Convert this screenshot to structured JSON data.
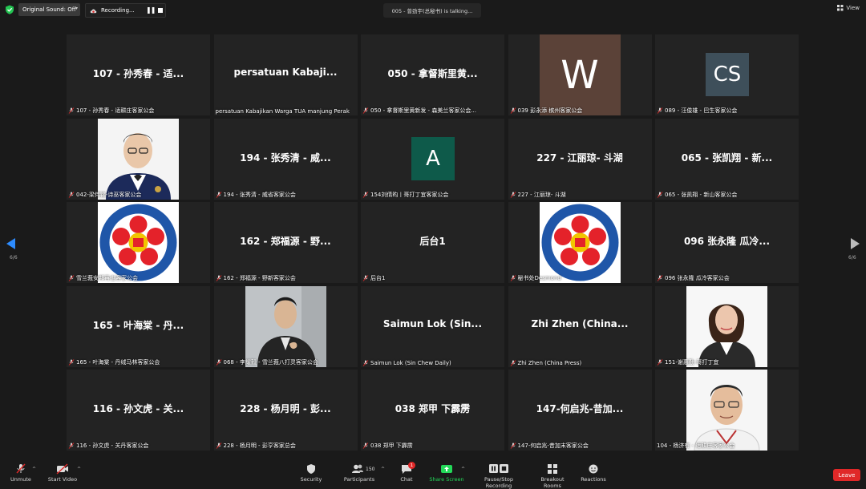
{
  "top": {
    "sound_label": "Original Sound: Off",
    "recording_label": "Recording...",
    "talking_label": "005 - 曾劲宇(总秘书)  is  talking...",
    "view_label": "View"
  },
  "tiles": [
    {
      "name": "107 - 孙秀春 - 适...",
      "caption": "107 - 孙秀春 - 适耕庄客家公会",
      "kind": "text"
    },
    {
      "name": "persatuan Kabaji...",
      "caption": "persatuan Kabajikan Warga TUA manjung Perak",
      "kind": "text",
      "nomic": true
    },
    {
      "name": "050 - 拿督斯里黄...",
      "caption": "050 - 拿督斯里黄新发 - 森美兰客家公会...",
      "kind": "text"
    },
    {
      "name": "",
      "caption": "039  彭永添 槟州客家公会",
      "kind": "initial",
      "initial": "W",
      "color": "#5b4238"
    },
    {
      "name": "",
      "caption": "089 - 汪俊雄 - 巴生客家公会",
      "kind": "initial-small",
      "initial": "CS",
      "color": "#3e4f5a"
    },
    {
      "name": "",
      "caption": "042-梁伟铭-诗巫客家公会",
      "kind": "photo-man1"
    },
    {
      "name": "194 - 张秀清 - 威...",
      "caption": "194 - 张秀清 - 威省客家公会",
      "kind": "text"
    },
    {
      "name": "",
      "caption": "154刘倩昀丨哥打丁宜客家公会",
      "kind": "initial-small",
      "initial": "A",
      "color": "#0e5a4a"
    },
    {
      "name": "227 - 江丽琼- 斗湖",
      "caption": "227 - 江丽琼- 斗湖",
      "kind": "text"
    },
    {
      "name": "065 - 张凯翔 - 新...",
      "caption": "065 - 张凯翔 - 新山客家公会",
      "kind": "text"
    },
    {
      "name": "",
      "caption": "雪兰莪安邦再也客家公会",
      "kind": "logo"
    },
    {
      "name": "162 - 郑福源 - 野...",
      "caption": "162 - 郑福源 - 野新客家公会",
      "kind": "text"
    },
    {
      "name": "后台1",
      "caption": "后台1",
      "kind": "text"
    },
    {
      "name": "",
      "caption": "秘书处Desmond",
      "kind": "logo"
    },
    {
      "name": "096 张永隆 瓜冷...",
      "caption": "096 张永隆 瓜冷客家公会",
      "kind": "text"
    },
    {
      "name": "165 - 叶海棠 - 丹...",
      "caption": "165 - 叶海棠 - 丹绒马林客家公会",
      "kind": "text"
    },
    {
      "name": "",
      "caption": "068 - 李耀毅 - 雪兰莪八打灵客家公会",
      "kind": "photo-man2"
    },
    {
      "name": "Saimun Lok (Sin...",
      "caption": "Saimun Lok (Sin Chew Daily)",
      "kind": "text"
    },
    {
      "name": "Zhi Zhen (China...",
      "caption": "Zhi Zhen (China Press)",
      "kind": "text"
    },
    {
      "name": "",
      "caption": "151-谢惠勤-哥打丁宜",
      "kind": "photo-woman"
    },
    {
      "name": "116 - 孙文虎 - 关...",
      "caption": "116 - 孙文虎 - 关丹客家公会",
      "kind": "text"
    },
    {
      "name": "228 - 杨月明 - 彭...",
      "caption": "228 - 杨月明 - 彭亨客家总会",
      "kind": "text"
    },
    {
      "name": "038 郑甲 下霹雳",
      "caption": "038 郑甲 下霹雳",
      "kind": "text"
    },
    {
      "name": "147-何启兆-昔加...",
      "caption": "147-何启兆-昔加末客家公会",
      "kind": "text"
    },
    {
      "name": "",
      "caption": "104 - 杨济有 - 适耕庄客家公会",
      "kind": "photo-man3",
      "nomic": true
    }
  ],
  "pagination": {
    "left": "6/6",
    "right": "6/6"
  },
  "toolbar": {
    "unmute": "Unmute",
    "start_video": "Start Video",
    "security": "Security",
    "participants": "Participants",
    "participants_count": "150",
    "chat": "Chat",
    "chat_badge": "1",
    "share_screen": "Share Screen",
    "pause_stop": "Pause/Stop Recording",
    "breakout": "Breakout Rooms",
    "reactions": "Reactions",
    "leave": "Leave"
  },
  "colors": {
    "share_green": "#23d959",
    "leave_red": "#e02828",
    "nav_blue": "#2d8cff"
  }
}
